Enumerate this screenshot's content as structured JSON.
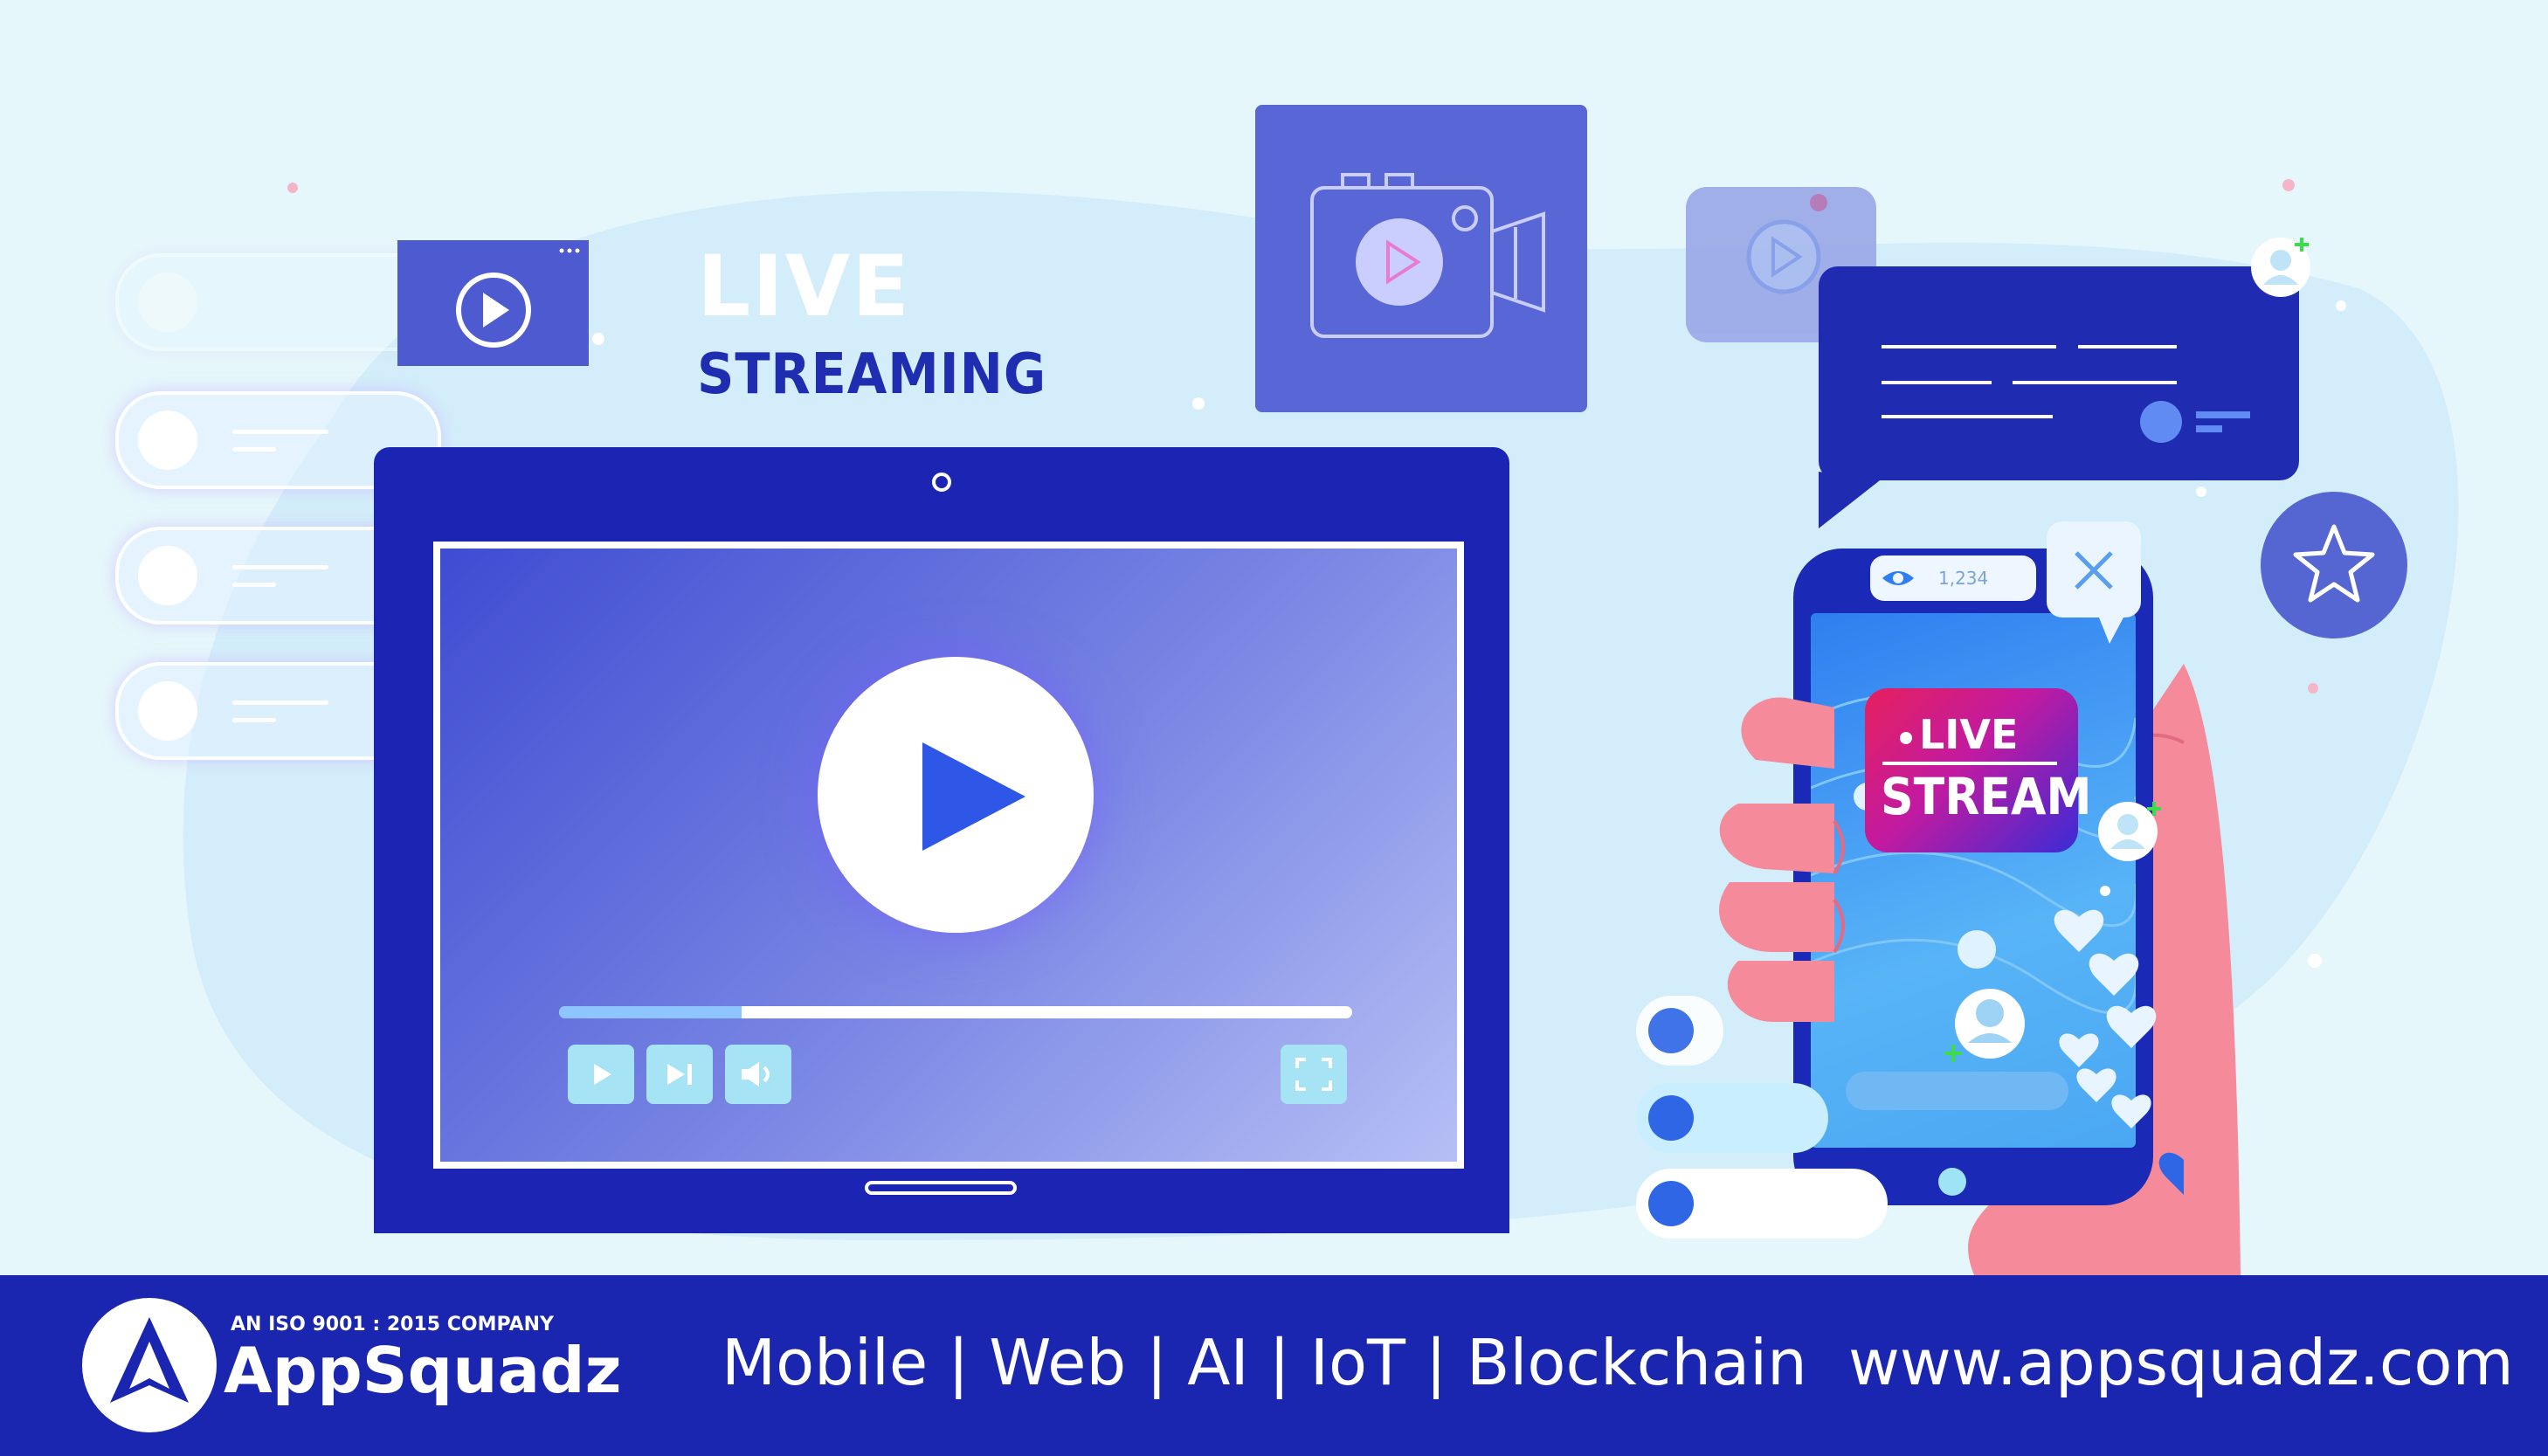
{
  "banner": {
    "title_line1": "LIVE",
    "title_line2": "STREAMING"
  },
  "video_player": {
    "progress": 0.23,
    "controls": [
      {
        "name": "play-icon"
      },
      {
        "name": "skip-next-icon"
      },
      {
        "name": "volume-icon"
      },
      {
        "name": "fullscreen-icon"
      }
    ]
  },
  "phone": {
    "viewer_count": "1,234",
    "badge_line1": "LIVE",
    "badge_line2": "STREAM"
  },
  "footer": {
    "iso_label": "AN ISO 9001 : 2015 COMPANY",
    "brand_name": "AppSquadz",
    "services": "Mobile | Web | AI | IoT | Blockchain",
    "website": "www.appsquadz.com"
  },
  "colors": {
    "navy": "#1c24b4",
    "footer_bg": "#1a25b0",
    "background": "#e6f7fb",
    "accent_blue": "#2e57e8",
    "hand_pink": "#f48a9a"
  }
}
